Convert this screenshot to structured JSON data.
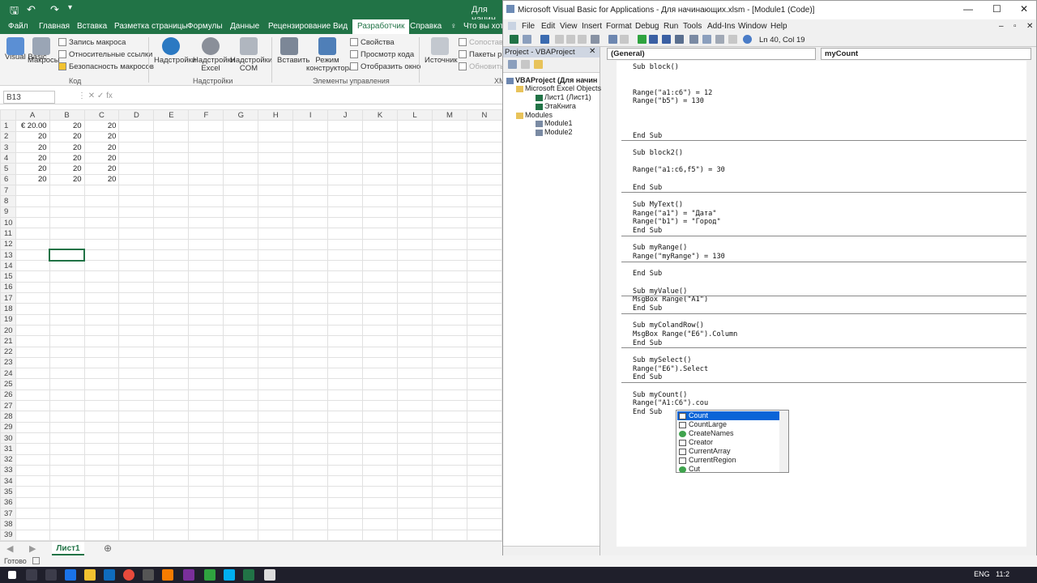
{
  "excel": {
    "title_partial": "Для начин",
    "tabs": [
      "Файл",
      "Главная",
      "Вставка",
      "Разметка страницы",
      "Формулы",
      "Данные",
      "Рецензирование",
      "Вид",
      "Разработчик",
      "Справка",
      "Что вы хоти"
    ],
    "active_tab": "Разработчик",
    "ribbon": {
      "visual_basic": "Visual Basic",
      "macros": "Макросы",
      "record_macro": "Запись макроса",
      "relative_refs": "Относительные ссылки",
      "macro_security": "Безопасность макросов",
      "group_code": "Код",
      "addins": "Надстройки",
      "excel_addins": "Надстройки Excel",
      "com_addins": "Надстройки COM",
      "group_addins": "Надстройки",
      "insert": "Вставить",
      "design_mode": "Режим конструктора",
      "properties": "Свойства",
      "view_code": "Просмотр кода",
      "run_dialog": "Отобразить окно",
      "group_controls": "Элементы управления",
      "source": "Источник",
      "map_props": "Сопостав",
      "packs": "Пакеты рас",
      "refresh": "Обновить д",
      "group_xml": "XML"
    },
    "name_box": "B13",
    "formula_icons": "⋮   ✕   ✓   fx",
    "columns": [
      "A",
      "B",
      "C",
      "D",
      "E",
      "F",
      "G",
      "H",
      "I",
      "J",
      "K",
      "L",
      "M",
      "N"
    ],
    "rows": [
      [
        "€   20.00",
        "20",
        "20"
      ],
      [
        "20",
        "20",
        "20"
      ],
      [
        "20",
        "20",
        "20"
      ],
      [
        "20",
        "20",
        "20"
      ],
      [
        "20",
        "20",
        "20"
      ],
      [
        "20",
        "20",
        "20"
      ]
    ],
    "row_count": 39,
    "sheet_tab": "Лист1",
    "status": "Готово"
  },
  "vbe": {
    "title": "Microsoft Visual Basic for Applications - Для начинающих.xlsm - [Module1 (Code)]",
    "menu": [
      "File",
      "Edit",
      "View",
      "Insert",
      "Format",
      "Debug",
      "Run",
      "Tools",
      "Add-Ins",
      "Window",
      "Help"
    ],
    "position": "Ln 40, Col 19",
    "project_title": "Project - VBAProject",
    "tree": [
      "VBAProject (Для начин",
      "Microsoft Excel Objects",
      "Лист1 (Лист1)",
      "ЭтаКнига",
      "Modules",
      "Module1",
      "Module2"
    ],
    "object_combo": "(General)",
    "proc_combo": "myCount",
    "code": [
      "Sub block()",
      "Range(\"a1:c6\") = 12",
      "Range(\"b5\") = 130",
      "End Sub",
      "Sub block2()",
      "Range(\"a1:c6,f5\") = 30",
      "End Sub",
      "Sub MyText()",
      "Range(\"a1\") = \"Дата\"",
      "Range(\"b1\") = \"Город\"",
      "End Sub",
      "Sub myRange()",
      "Range(\"myRange\") = 130",
      "End Sub",
      "Sub myValue()",
      "MsgBox Range(\"A1\")",
      "End Sub",
      "Sub myColandRow()",
      "MsgBox Range(\"E6\").Column",
      "End Sub",
      "Sub mySelect()",
      "Range(\"E6\").Select",
      "End Sub",
      "Sub myCount()",
      "Range(\"A1:C6\").cou",
      "End Sub"
    ],
    "autocomplete": [
      "Count",
      "CountLarge",
      "CreateNames",
      "Creator",
      "CurrentArray",
      "CurrentRegion",
      "Cut"
    ]
  },
  "taskbar": {
    "lang": "ENG",
    "time": "11:2"
  },
  "colors": {
    "excel_green": "#217346",
    "selection_blue": "#0a64d7"
  }
}
